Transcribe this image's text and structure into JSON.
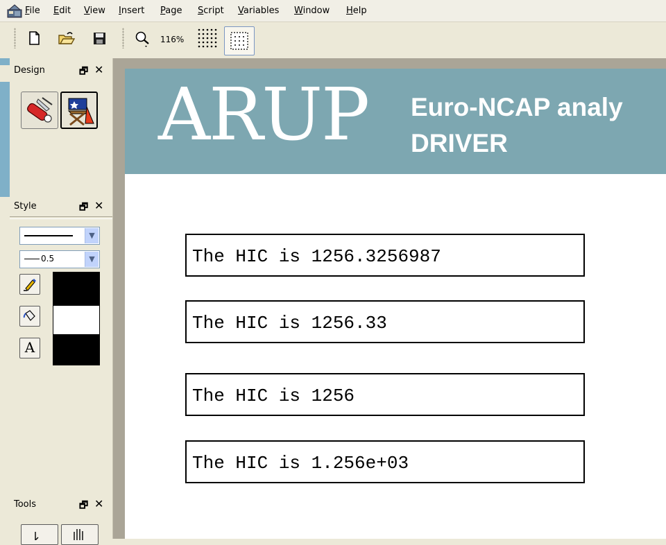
{
  "menu": {
    "items": [
      "File",
      "Edit",
      "View",
      "Insert",
      "Page",
      "Script",
      "Variables",
      "Window",
      "Help"
    ]
  },
  "toolbar": {
    "zoom_label": "116%",
    "icons": [
      "new-document-icon",
      "open-folder-icon",
      "save-disk-icon",
      "zoom-magnifier-icon",
      "grid-dots-icon",
      "snap-grid-icon"
    ]
  },
  "panels": {
    "design": {
      "title": "Design",
      "pin": "🗗",
      "close": "✕"
    },
    "style": {
      "title": "Style",
      "pin": "🗗",
      "close": "✕",
      "line_width": "0.5",
      "text_button": "A",
      "colors": {
        "line": "#000000",
        "fill": "#ffffff",
        "text": "#000000"
      }
    },
    "tools": {
      "title": "Tools",
      "pin": "🗗",
      "close": "✕"
    }
  },
  "page": {
    "banner": {
      "logo": "ARUP",
      "line1": "Euro-NCAP analy",
      "line2": "DRIVER",
      "color": "#7da7b1"
    },
    "hic_lines": [
      "The HIC is 1256.3256987",
      "The HIC is 1256.33",
      "The HIC is 1256",
      "The HIC is 1.256e+03"
    ]
  }
}
